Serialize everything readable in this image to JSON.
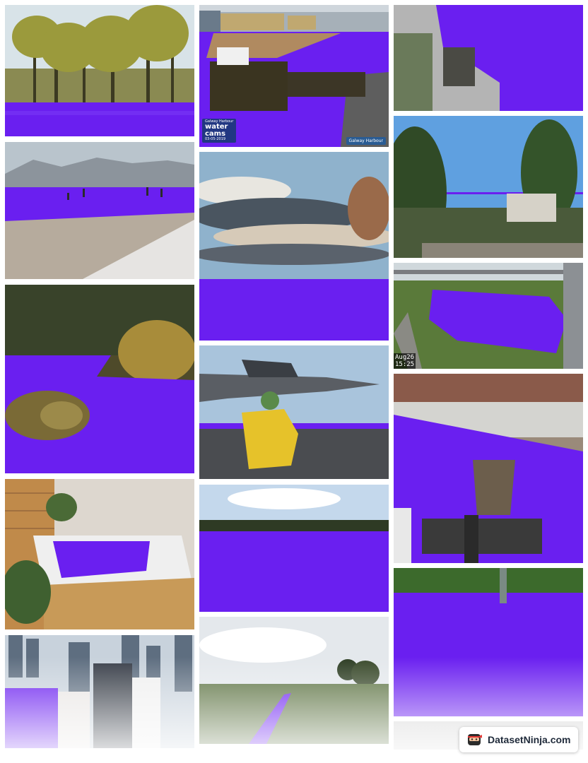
{
  "brand": {
    "name": "DatasetNinja.com",
    "icon": "ninja-icon"
  },
  "overlays": {
    "cam_line1": "Galway Harbour",
    "cam_line2": "water",
    "cam_line3": "cams",
    "cam_date": "03-05-2019",
    "harbour_label": "Galway Harbour",
    "stamp_date": "Aug26",
    "stamp_time": "15:25"
  },
  "colors": {
    "mask": "#6a1ff0",
    "background": "#ffffff"
  }
}
